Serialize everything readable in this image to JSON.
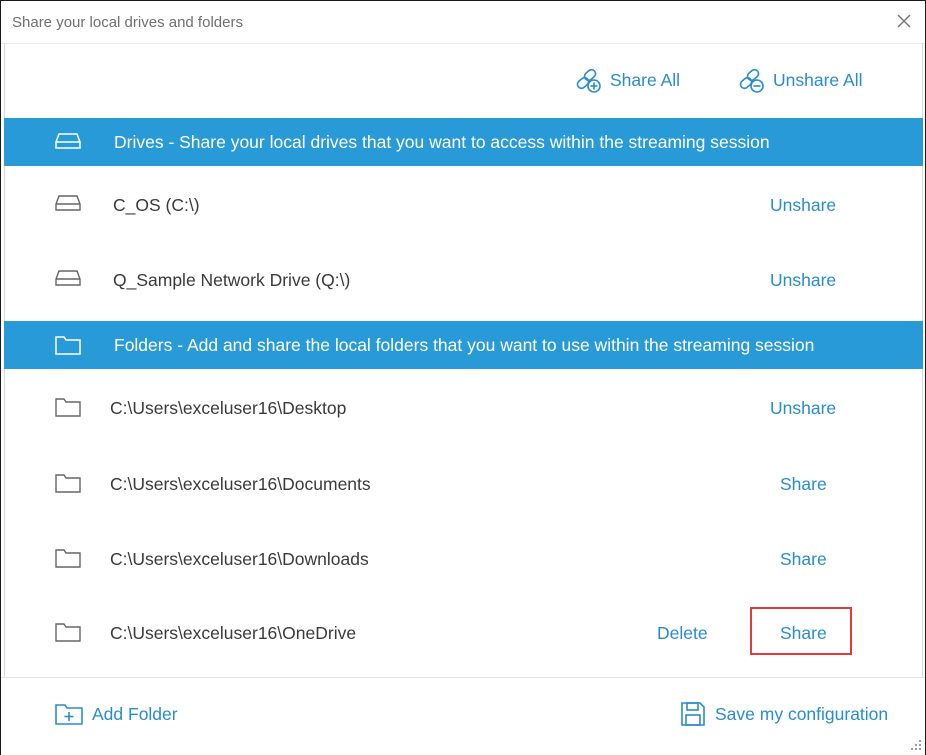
{
  "window": {
    "title": "Share your local drives and folders"
  },
  "toolbar": {
    "share_all_label": "Share All",
    "unshare_all_label": "Unshare All"
  },
  "drives": {
    "header": "Drives - Share your local drives that you want to access within the streaming session",
    "items": [
      {
        "label": "C_OS (C:\\)",
        "action": "Unshare"
      },
      {
        "label": "Q_Sample Network Drive (Q:\\)",
        "action": "Unshare"
      }
    ]
  },
  "folders": {
    "header": "Folders - Add and share the local folders that you want to use within the streaming session",
    "items": [
      {
        "label": "C:\\Users\\exceluser16\\Desktop",
        "action": "Unshare"
      },
      {
        "label": "C:\\Users\\exceluser16\\Documents",
        "action": "Share"
      },
      {
        "label": "C:\\Users\\exceluser16\\Downloads",
        "action": "Share"
      },
      {
        "label": "C:\\Users\\exceluser16\\OneDrive",
        "action": "Share",
        "delete": "Delete"
      }
    ]
  },
  "footer": {
    "add_folder_label": "Add Folder",
    "save_label": "Save my configuration"
  },
  "colors": {
    "accent": "#289ad8",
    "link": "#2a8ccf",
    "highlight": "#e23b3b"
  },
  "icons": {
    "close": "close-icon",
    "share_all": "link-add-icon",
    "unshare_all": "link-remove-icon",
    "drive": "drive-icon",
    "folder": "folder-icon",
    "add_folder": "folder-add-icon",
    "save": "floppy-disk-icon"
  }
}
